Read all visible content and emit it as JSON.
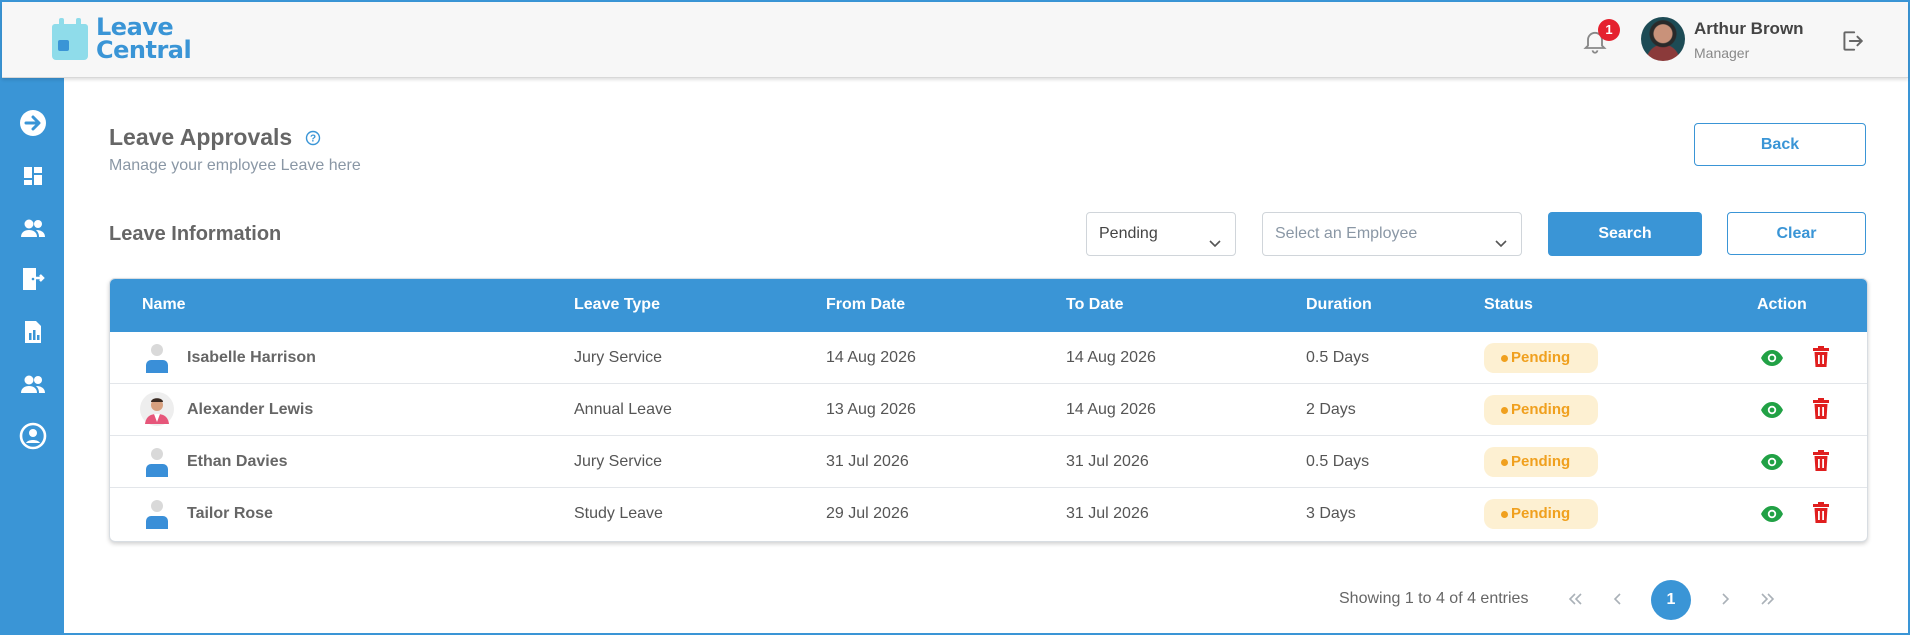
{
  "app": {
    "logo_line1": "Leave",
    "logo_line2": "Central",
    "notification_count": "1",
    "user_name": "Arthur Brown",
    "user_role": "Manager",
    "accent_color": "#3a95d6"
  },
  "sidebar": {
    "items": [
      {
        "icon": "arrow-right-circle-icon"
      },
      {
        "icon": "dashboard-icon"
      },
      {
        "icon": "users-icon"
      },
      {
        "icon": "leave-door-icon"
      },
      {
        "icon": "report-icon"
      },
      {
        "icon": "team-icon"
      },
      {
        "icon": "account-circle-icon"
      }
    ]
  },
  "page": {
    "title": "Leave Approvals",
    "subtitle": "Manage your employee Leave here",
    "back_label": "Back"
  },
  "filters": {
    "section_title": "Leave Information",
    "status_value": "Pending",
    "employee_placeholder": "Select an Employee",
    "search_label": "Search",
    "clear_label": "Clear"
  },
  "table": {
    "columns": [
      "Name",
      "Leave Type",
      "From Date",
      "To Date",
      "Duration",
      "Status",
      "Action"
    ],
    "rows": [
      {
        "name": "Isabelle Harrison",
        "leave_type": "Jury Service",
        "from": "14 Aug 2026",
        "to": "14 Aug 2026",
        "duration": "0.5 Days",
        "status": "Pending"
      },
      {
        "name": "Alexander Lewis",
        "leave_type": "Annual Leave",
        "from": "13 Aug 2026",
        "to": "14 Aug 2026",
        "duration": "2 Days",
        "status": "Pending"
      },
      {
        "name": "Ethan Davies",
        "leave_type": "Jury Service",
        "from": "31 Jul 2026",
        "to": "31 Jul 2026",
        "duration": "0.5 Days",
        "status": "Pending"
      },
      {
        "name": "Tailor Rose",
        "leave_type": "Study Leave",
        "from": "29 Jul 2026",
        "to": "31 Jul 2026",
        "duration": "3 Days",
        "status": "Pending"
      }
    ]
  },
  "pagination": {
    "summary": "Showing 1 to 4 of 4 entries",
    "current_page": "1"
  }
}
